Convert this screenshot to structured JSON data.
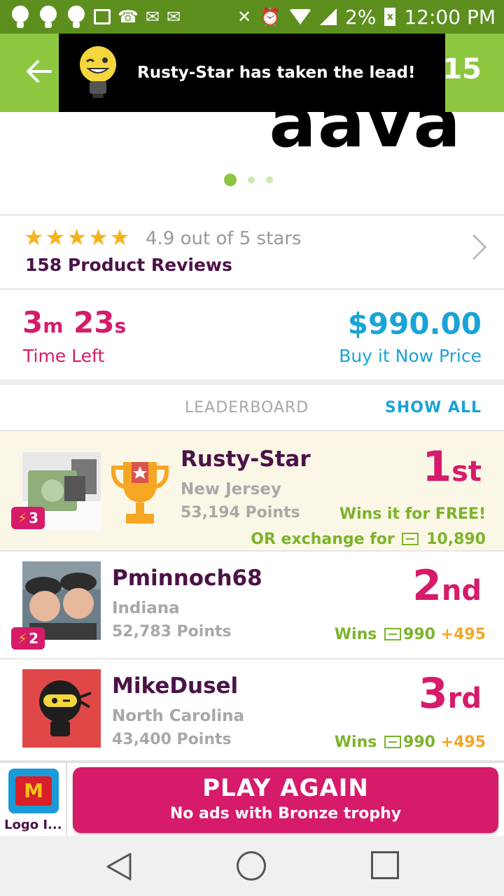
{
  "status_bar": {
    "battery": "2%",
    "time": "12:00 PM"
  },
  "app_bar": {
    "count": "15"
  },
  "toast": {
    "message": "Rusty-Star has taken the lead!"
  },
  "hero": {
    "logo_text": "aava"
  },
  "reviews": {
    "stars": 5,
    "rating_text": "4.9 out of 5 stars",
    "count_text": "158 Product Reviews"
  },
  "auction": {
    "time_minutes": "3",
    "time_minutes_unit": "m",
    "time_seconds": "23",
    "time_seconds_unit": "s",
    "time_label": "Time Left",
    "price": "$990.00",
    "price_label": "Buy it Now Price"
  },
  "leaderboard": {
    "title": "LEADERBOARD",
    "show_all": "SHOW ALL",
    "entries": [
      {
        "name": "Rusty-Star",
        "location": "New Jersey",
        "points": "53,194 Points",
        "badge": "3",
        "rank_num": "1",
        "rank_suffix": "st",
        "prize": "Wins it for FREE!",
        "exchange_label": "OR exchange for",
        "exchange_value": "10,890"
      },
      {
        "name": "Pminnoch68",
        "location": "Indiana",
        "points": "52,783 Points",
        "badge": "2",
        "rank_num": "2",
        "rank_suffix": "nd",
        "wins_label": "Wins",
        "wins_value": "990",
        "bonus": "+495"
      },
      {
        "name": "MikeDusel",
        "location": "North Carolina",
        "points": "43,400 Points",
        "rank_num": "3",
        "rank_suffix": "rd",
        "wins_label": "Wins",
        "wins_value": "990",
        "bonus": "+495"
      }
    ]
  },
  "ad": {
    "label": "Logo I..."
  },
  "play_button": {
    "title": "PLAY AGAIN",
    "subtitle": "No ads with Bronze trophy"
  },
  "colors": {
    "brand_green": "#8dc63f",
    "status_green": "#5d8f1f",
    "magenta": "#d61b6a",
    "blue": "#1aa3d8",
    "purple": "#4b1248"
  }
}
